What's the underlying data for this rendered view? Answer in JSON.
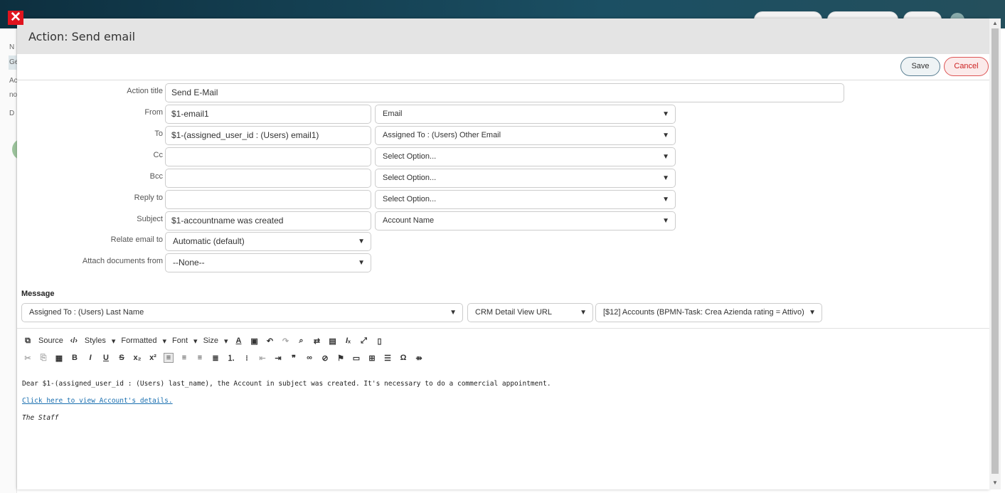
{
  "dialog": {
    "title": "Action: Send email",
    "close_icon": "close-icon",
    "save_label": "Save",
    "cancel_label": "Cancel"
  },
  "background": {
    "left_letters": [
      "N",
      "Ge",
      "Ac",
      "no",
      "D"
    ]
  },
  "form": {
    "action_title": {
      "label": "Action title",
      "value": "Send E-Mail"
    },
    "from": {
      "label": "From",
      "value": "$1-email1",
      "select": "Email"
    },
    "to": {
      "label": "To",
      "value": "$1-(assigned_user_id : (Users) email1)",
      "select": "Assigned To : (Users) Other Email"
    },
    "cc": {
      "label": "Cc",
      "value": "",
      "select": "Select Option..."
    },
    "bcc": {
      "label": "Bcc",
      "value": "",
      "select": "Select Option..."
    },
    "reply_to": {
      "label": "Reply to",
      "value": "",
      "select": "Select Option..."
    },
    "subject": {
      "label": "Subject",
      "value": "$1-accountname was created",
      "select": "Account Name"
    },
    "relate": {
      "label": "Relate email to",
      "select": "Automatic (default)"
    },
    "attach": {
      "label": "Attach documents from",
      "select": "--None--"
    }
  },
  "message": {
    "label": "Message",
    "field_select": "Assigned To : (Users) Last Name",
    "url_select": "CRM Detail View URL",
    "record_select": "[$12] Accounts (BPMN-Task: Crea Azienda rating = Attivo)"
  },
  "toolbar": {
    "source": "Source",
    "styles": "Styles",
    "formatted": "Formatted",
    "font": "Font",
    "size": "Size"
  },
  "body": {
    "line1": "Dear $1-(assigned_user_id : (Users) last_name), the Account in subject was created. It's necessary to do a commercial appointment.",
    "link": "Click here to view Account's details.",
    "signature": "The Staff"
  }
}
